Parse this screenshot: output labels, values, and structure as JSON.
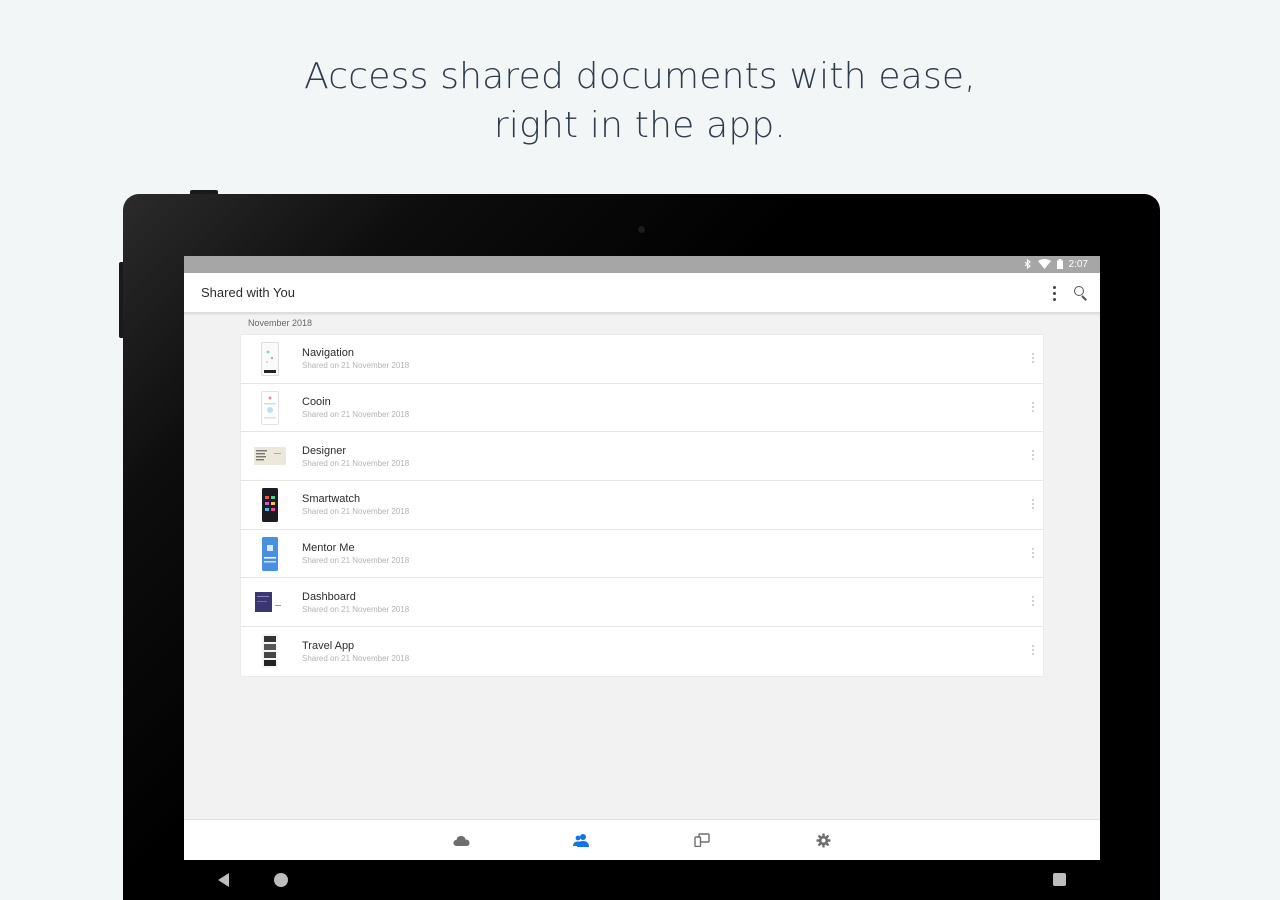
{
  "headline": {
    "line1": "Access shared documents with ease,",
    "line2": "right in the app."
  },
  "statusbar": {
    "time": "2:07",
    "icons": [
      "bluetooth-icon",
      "wifi-icon",
      "battery-icon"
    ]
  },
  "appbar": {
    "title": "Shared with You",
    "actions": [
      "more-options-icon",
      "search-icon"
    ]
  },
  "list": {
    "section_label": "November 2018",
    "items": [
      {
        "name": "Navigation",
        "subtitle": "Shared on 21 November 2018",
        "thumb": "phone-light"
      },
      {
        "name": "Cooin",
        "subtitle": "Shared on 21 November 2018",
        "thumb": "phone-white"
      },
      {
        "name": "Designer",
        "subtitle": "Shared on 21 November 2018",
        "thumb": "web-beige"
      },
      {
        "name": "Smartwatch",
        "subtitle": "Shared on 21 November 2018",
        "thumb": "phone-dark"
      },
      {
        "name": "Mentor Me",
        "subtitle": "Shared on 21 November 2018",
        "thumb": "phone-blue"
      },
      {
        "name": "Dashboard",
        "subtitle": "Shared on 21 November 2018",
        "thumb": "web-purple"
      },
      {
        "name": "Travel App",
        "subtitle": "Shared on 21 November 2018",
        "thumb": "phone-photos"
      }
    ]
  },
  "bottomnav": {
    "items": [
      "cloud-icon",
      "shared-people-icon",
      "devices-icon",
      "settings-gear-icon"
    ],
    "active": "shared-people-icon",
    "active_color": "#1473e6",
    "inactive_color": "#6e6e6e"
  },
  "system_nav": [
    "back-icon",
    "home-icon",
    "recents-icon"
  ]
}
